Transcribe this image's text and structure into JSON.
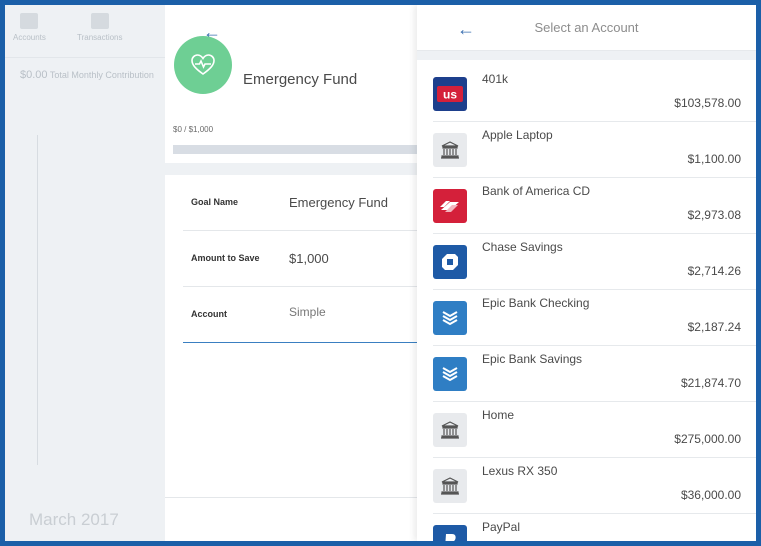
{
  "background_app": {
    "nav_items": [
      "Accounts",
      "Transactions"
    ],
    "total_amount": "$0.00",
    "total_label": "Total Monthly Contribution",
    "month_label": "March 2017"
  },
  "goal": {
    "title": "Emergency Fund",
    "progress_text": "$0 / $1,000",
    "progress_fraction": 0,
    "fields": [
      {
        "label": "Goal Name",
        "value": "Emergency Fund"
      },
      {
        "label": "Amount to Save",
        "value": "$1,000"
      },
      {
        "label": "Account",
        "value": "Simple"
      }
    ],
    "icon": "heart-pulse-icon",
    "icon_color": "#6ecf94"
  },
  "account_selector": {
    "title": "Select an Account",
    "accounts": [
      {
        "name": "401k",
        "balance": "$103,578.00",
        "logo": "us-bank-logo"
      },
      {
        "name": "Apple Laptop",
        "balance": "$1,100.00",
        "logo": "bank-building-icon"
      },
      {
        "name": "Bank of America CD",
        "balance": "$2,973.08",
        "logo": "bank-of-america-logo"
      },
      {
        "name": "Chase Savings",
        "balance": "$2,714.26",
        "logo": "chase-logo"
      },
      {
        "name": "Epic Bank Checking",
        "balance": "$2,187.24",
        "logo": "epic-bank-logo"
      },
      {
        "name": "Epic Bank Savings",
        "balance": "$21,874.70",
        "logo": "epic-bank-logo"
      },
      {
        "name": "Home",
        "balance": "$275,000.00",
        "logo": "bank-building-icon"
      },
      {
        "name": "Lexus RX 350",
        "balance": "$36,000.00",
        "logo": "bank-building-icon"
      },
      {
        "name": "PayPal",
        "balance": "",
        "logo": "paypal-logo"
      }
    ]
  },
  "colors": {
    "frame": "#1b5fa8",
    "accent": "#3a7fc1",
    "goal_green": "#6ecf94"
  }
}
